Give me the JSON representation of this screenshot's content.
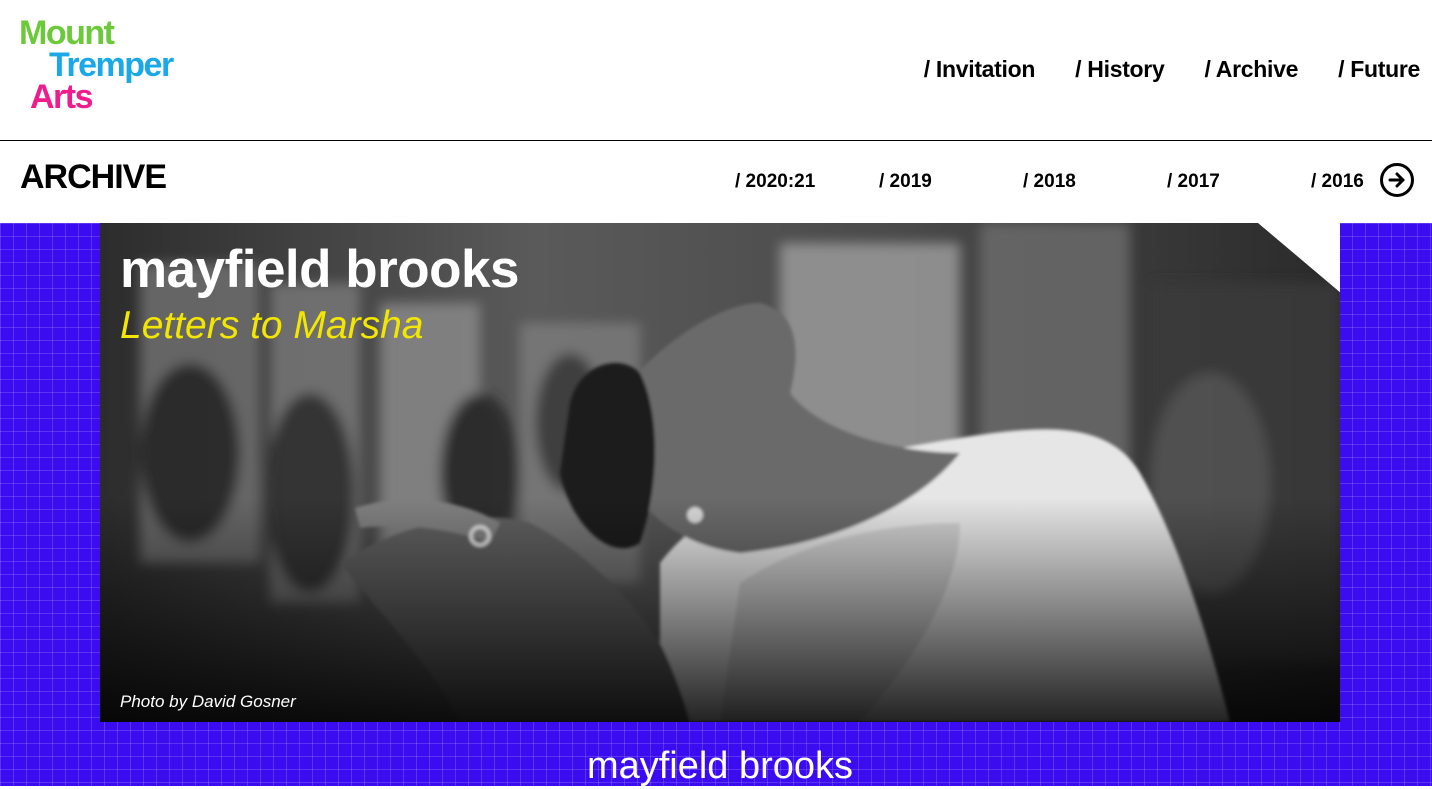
{
  "logo": {
    "line1": "Mount",
    "line2": "Tremper",
    "line3": "Arts",
    "colors": {
      "line1": "#6bc93a",
      "line2": "#1aa8e8",
      "line3": "#ef1c8c"
    }
  },
  "nav": {
    "items": [
      "/ Invitation",
      "/ History",
      "/ Archive",
      "/ Future"
    ]
  },
  "archive": {
    "title": "ARCHIVE",
    "years": [
      "/ 2020:21",
      "/ 2019",
      "/ 2018",
      "/ 2017",
      "/ 2016"
    ],
    "next_icon": "arrow-right-circle-icon"
  },
  "hero": {
    "artist": "mayfield brooks",
    "work": "Letters to Marsha",
    "credit": "Photo by David Gosner",
    "subtitle_color": "#f3e600"
  },
  "below_title": "mayfield brooks",
  "colors": {
    "background": "#3c0cf0",
    "text": "#000000"
  }
}
